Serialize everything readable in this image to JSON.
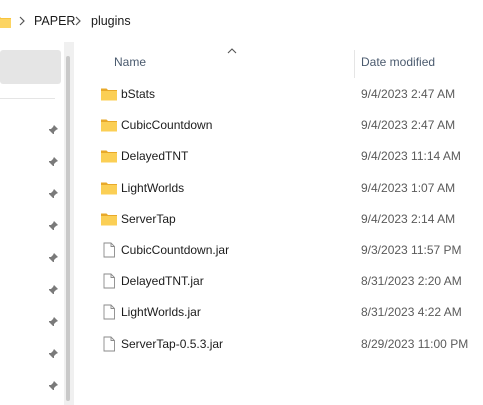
{
  "breadcrumb": {
    "items": [
      "PAPER",
      "plugins"
    ]
  },
  "columns": {
    "name": "Name",
    "date_modified": "Date modified"
  },
  "files": [
    {
      "name": "bStats",
      "date": "9/4/2023 2:47 AM",
      "type": "folder"
    },
    {
      "name": "CubicCountdown",
      "date": "9/4/2023 2:47 AM",
      "type": "folder"
    },
    {
      "name": "DelayedTNT",
      "date": "9/4/2023 11:14 AM",
      "type": "folder"
    },
    {
      "name": "LightWorlds",
      "date": "9/4/2023 1:07 AM",
      "type": "folder"
    },
    {
      "name": "ServerTap",
      "date": "9/4/2023 2:14 AM",
      "type": "folder"
    },
    {
      "name": "CubicCountdown.jar",
      "date": "9/3/2023 11:57 PM",
      "type": "file"
    },
    {
      "name": "DelayedTNT.jar",
      "date": "8/31/2023 2:20 AM",
      "type": "file"
    },
    {
      "name": "LightWorlds.jar",
      "date": "8/31/2023 4:22 AM",
      "type": "file"
    },
    {
      "name": "ServerTap-0.5.3.jar",
      "date": "8/29/2023 11:00 PM",
      "type": "file"
    }
  ],
  "icons": {
    "folder": "folder-icon",
    "file": "file-icon",
    "pin": "pin-icon"
  },
  "colors": {
    "folder_yellow": "#f8c43e",
    "selection_gray": "#e5e5e5"
  }
}
